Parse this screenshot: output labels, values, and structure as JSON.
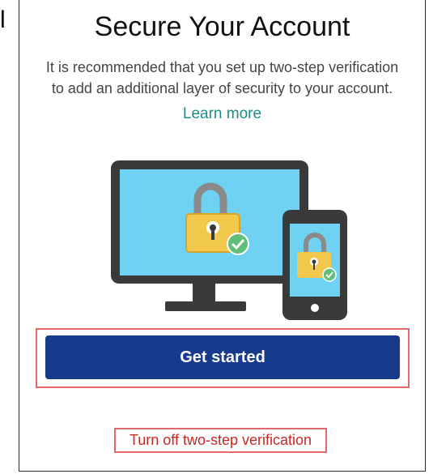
{
  "edge_glyph": "l",
  "title": "Secure Your Account",
  "description_line1": "It is recommended that you set up two-step verification",
  "description_line2": "to add an additional layer of security to your account.",
  "learn_more": "Learn more",
  "primary_button": "Get started",
  "secondary_link": "Turn off two-step verification",
  "colors": {
    "primary": "#173a8c",
    "link": "#1b8d88",
    "danger_link": "#c62828",
    "highlight_outline": "#e3686a",
    "lock": "#f2c94c",
    "check": "#5fbf7a"
  },
  "icons": [
    "desktop-lock-icon",
    "phone-lock-icon",
    "check-icon"
  ]
}
